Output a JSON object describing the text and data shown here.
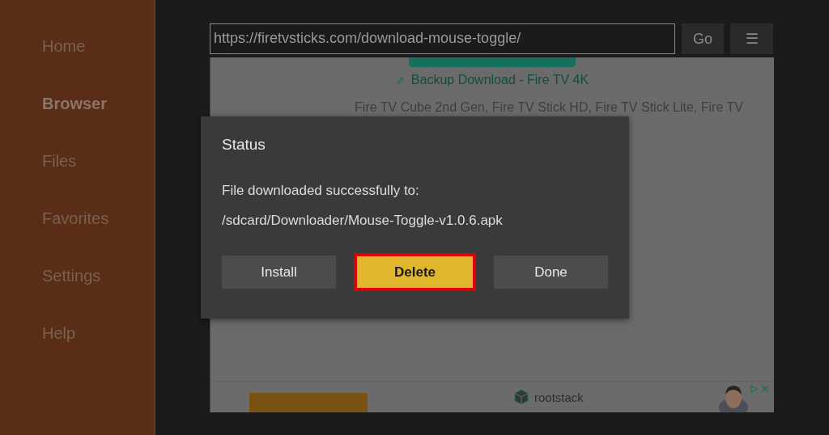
{
  "sidebar": {
    "items": [
      {
        "label": "Home",
        "selected": false
      },
      {
        "label": "Browser",
        "selected": true
      },
      {
        "label": "Files",
        "selected": false
      },
      {
        "label": "Favorites",
        "selected": false
      },
      {
        "label": "Settings",
        "selected": false
      },
      {
        "label": "Help",
        "selected": false
      }
    ]
  },
  "address_bar": {
    "value": "https://firetvsticks.com/download-mouse-toggle/",
    "go_button": "Go",
    "menu_button": "☰"
  },
  "web_page": {
    "link": "Backup Download - Fire TV 4K",
    "paragraph": "Fire TV Cube 2nd Gen, Fire TV Stick HD, Fire TV Stick Lite, Fire TV",
    "ad": {
      "brand": "rootstack"
    }
  },
  "dialog": {
    "title": "Status",
    "message": "File downloaded successfully to:",
    "path": "/sdcard/Downloader/Mouse-Toggle-v1.0.6.apk",
    "buttons": [
      {
        "label": "Install",
        "selected": false
      },
      {
        "label": "Delete",
        "selected": true
      },
      {
        "label": "Done",
        "selected": false
      }
    ]
  }
}
